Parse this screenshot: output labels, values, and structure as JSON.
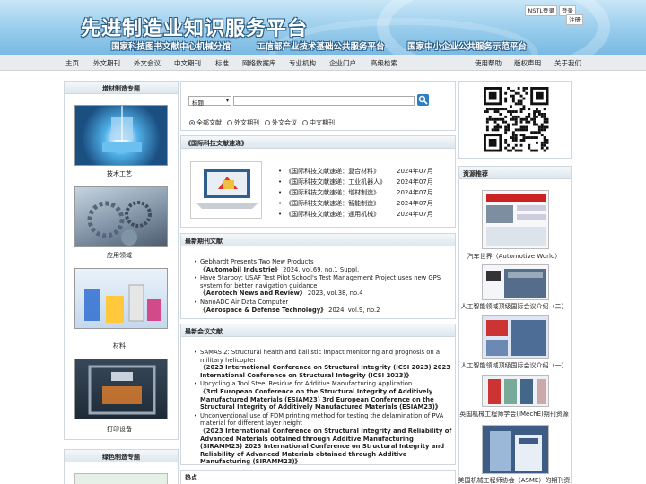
{
  "header": {
    "site_title": "先进制造业知识服务平台",
    "subtitles": [
      "国家科技图书文献中心机械分馆",
      "工信部产业技术基础公共服务平台",
      "国家中小企业公共服务示范平台"
    ],
    "login_nstl": "NSTL登录",
    "login": "登录",
    "register": "注册"
  },
  "nav": {
    "left": [
      "主页",
      "外文期刊",
      "外文会议",
      "中文期刊",
      "标准",
      "网络数据库",
      "专业机构",
      "企业门户",
      "高级检索"
    ],
    "right": [
      "使用帮助",
      "版权声明",
      "关于我们"
    ]
  },
  "left": {
    "panel1_title": "增材制造专题",
    "items": [
      "技术工艺",
      "应用领域",
      "材料",
      "打印设备"
    ],
    "panel2_title": "绿色制造专题"
  },
  "search": {
    "select_value": "标题",
    "options": [
      "全部文献",
      "外文期刊",
      "外文会议",
      "中文期刊"
    ]
  },
  "intl": {
    "title": "《国际科技文献速递》",
    "items": [
      {
        "title": "《国际科技文献速递：复合材料》",
        "date": "2024年07月"
      },
      {
        "title": "《国际科技文献速递：工业机器人》",
        "date": "2024年07月"
      },
      {
        "title": "《国际科技文献速递：增材制造》",
        "date": "2024年07月"
      },
      {
        "title": "《国际科技文献速递：智能制造》",
        "date": "2024年07月"
      },
      {
        "title": "《国际科技文献速递：通用机械》",
        "date": "2024年07月"
      }
    ]
  },
  "journals": {
    "title": "最新期刊文献",
    "items": [
      {
        "title": "Gebhardt Presents Two New Products",
        "source": "《Automobil Industrie》",
        "meta": " 2024, vol.69, no.1 Suppl."
      },
      {
        "title": "Have 5tarboy: USAF Test Pilot School's Test Management Project uses new GPS system for better navigation guidance",
        "source": "《Aerotech News and Review》",
        "meta": " 2023, vol.38, no.4"
      },
      {
        "title": "NanoADC Air Data Computer",
        "source": "《Aerospace & Defense Technology》",
        "meta": " 2024, vol.9, no.2"
      }
    ]
  },
  "conferences": {
    "title": "最新会议文献",
    "items": [
      {
        "title": "SAMAS 2: Structural health and ballistic impact monitoring and prognosis on a military helicopter",
        "source": "《2023 International Conference on Structural Integrity (ICSI 2023) 2023 International Conference on Structural Integrity (ICSI 2023)》"
      },
      {
        "title": "Upcycling a Tool Steel Residue for Additive Manufacturing Application",
        "source": "《3rd European Conference on the Structural Integrity of Additively Manufactured Materials (ESIAM23) 3rd European Conference on the Structural Integrity of Additively Manufactured Materials (ESIAM23)》"
      },
      {
        "title": "Unconventional use of FDM printing method for testing the delamination of PVA material for different layer height",
        "source": "《2023 International Conference on Structural Integrity and Reliability of Advanced Materials obtained through Additive Manufacturing (SIRAMM23) 2023 International Conference on Structural Integrity and Reliability of Advanced Materials obtained through Additive Manufacturing (SIRAMM23)》"
      }
    ]
  },
  "hot": {
    "title": "热点"
  },
  "right": {
    "title": "资源推荐",
    "items": [
      "汽车世界（Automotive World）",
      "人工智能领域顶级国际会议介绍（二）",
      "人工智能领域顶级国际会议介绍（一）",
      "英国机械工程师学会(IMechE)期刊资源",
      "美国机械工程师协会（ASME）的期刊资"
    ]
  }
}
